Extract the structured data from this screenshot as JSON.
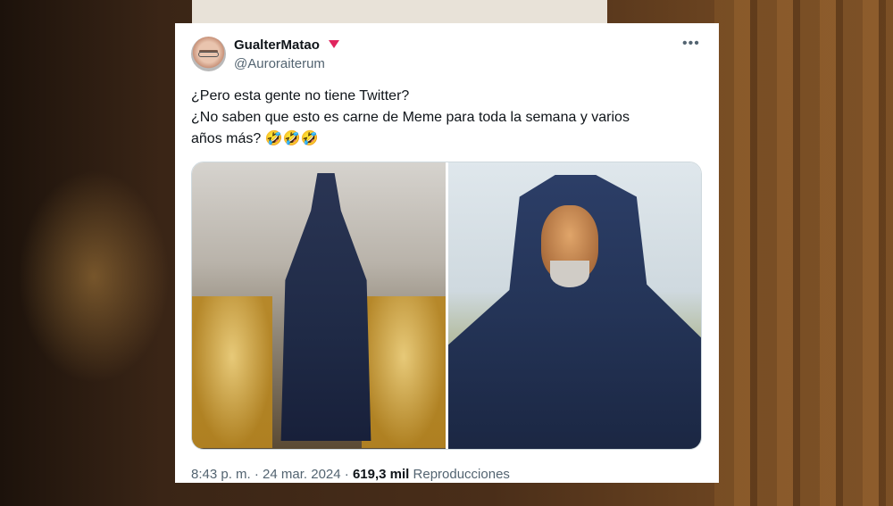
{
  "tweet": {
    "display_name": "GualterMatao",
    "handle": "@Auroraiterum",
    "text_lines": [
      "¿Pero esta gente no tiene Twitter?",
      "¿No saben que esto es carne de Meme para toda la semana y varios",
      "años más? 🤣🤣🤣"
    ],
    "time": "8:43 p. m.",
    "separator": "·",
    "date": "24 mar. 2024",
    "views_count": "619,3 mil",
    "views_label": "Reproducciones"
  },
  "icons": {
    "more": "more-options-icon",
    "badge": "red-triangle-badge-icon"
  },
  "colors": {
    "text_primary": "#0f1419",
    "text_secondary": "#536471",
    "badge": "#e0245e"
  }
}
